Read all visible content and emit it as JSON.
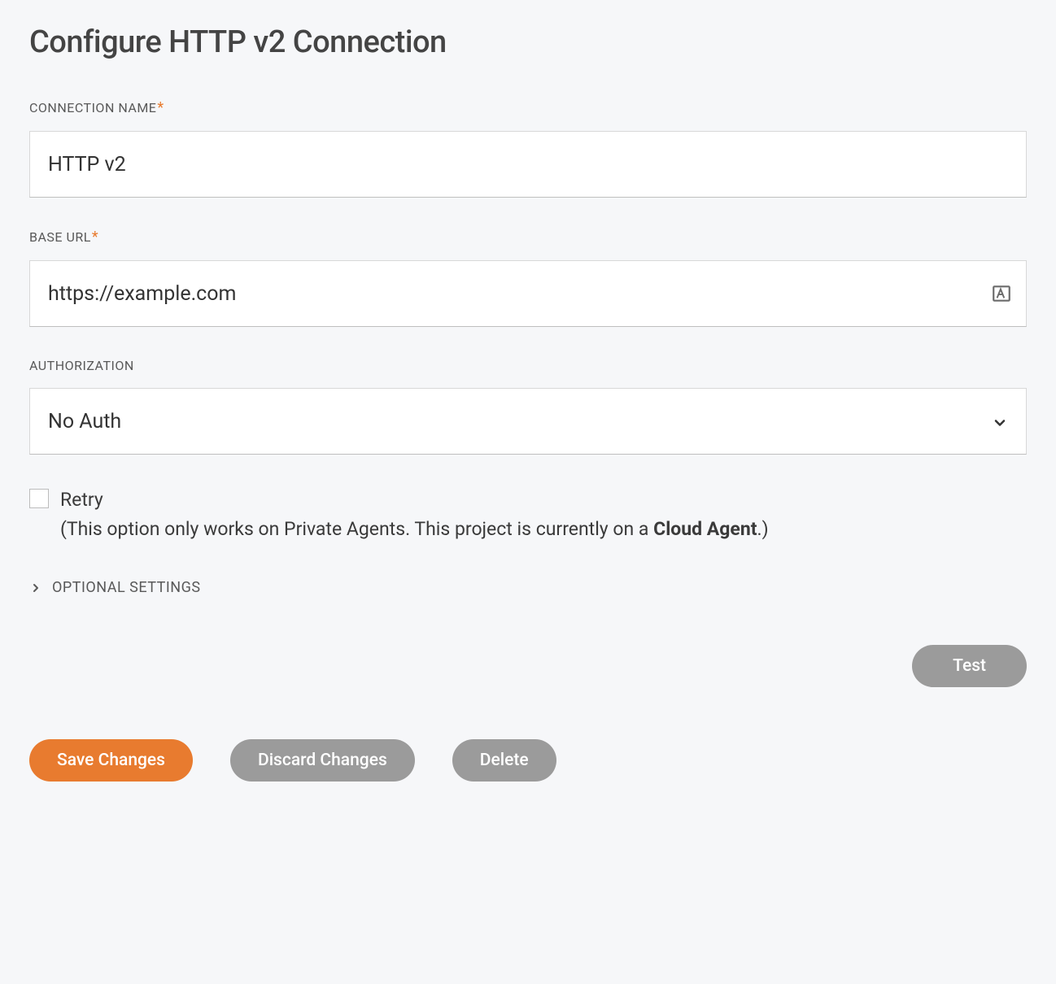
{
  "title": "Configure HTTP v2 Connection",
  "fields": {
    "connectionName": {
      "label": "CONNECTION NAME",
      "required": true,
      "value": "HTTP v2"
    },
    "baseUrl": {
      "label": "BASE URL",
      "required": true,
      "value": "https://example.com"
    },
    "authorization": {
      "label": "AUTHORIZATION",
      "required": false,
      "selected": "No Auth"
    }
  },
  "retry": {
    "label": "Retry",
    "checked": false,
    "hint_prefix": "(This option only works on Private Agents. This project is currently on a ",
    "hint_bold": "Cloud Agent",
    "hint_suffix": ".)"
  },
  "optionalSettings": {
    "label": "OPTIONAL SETTINGS",
    "expanded": false
  },
  "buttons": {
    "test": "Test",
    "save": "Save Changes",
    "discard": "Discard Changes",
    "delete": "Delete"
  }
}
